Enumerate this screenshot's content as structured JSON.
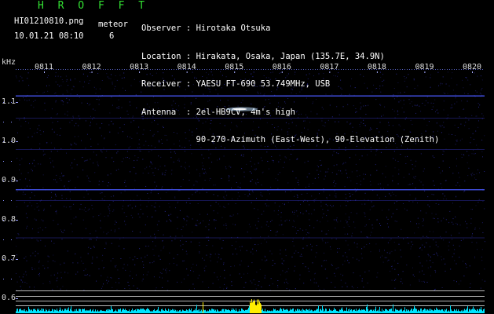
{
  "header": {
    "brand": "H R O F F T",
    "filename": "HI01210810.png",
    "datetime": "10.01.21 08:10",
    "meteor_label": "meteor",
    "meteor_count": "6"
  },
  "station_info": [
    {
      "label": "Observer ",
      "value": "Hirotaka Otsuka"
    },
    {
      "label": "Location ",
      "value": "Hirakata, Osaka, Japan (135.7E, 34.9N)"
    },
    {
      "label": "Receiver ",
      "value": "YAESU FT-690 53.749MHz, USB"
    },
    {
      "label": "Antenna  ",
      "value": "2el-HB9CV, 4m's high"
    },
    {
      "label": "",
      "value": "90-270-Azimuth (East-West), 90-Elevation (Zenith)"
    }
  ],
  "colors": {
    "background": "#000000",
    "brand": "#33e033",
    "text": "#ffffff",
    "noise": "#2a2a9a",
    "carrier_line": "#4a5aff",
    "meteor_echo": "#bfe0ff",
    "spectrum": "#00e5ff",
    "spectrum_peak": "#ffee00",
    "ref_lines": "#b8b8b8"
  },
  "chart_data": {
    "type": "heatmap",
    "title": "",
    "xlabel": "",
    "ylabel": "kHz",
    "x_ticks": [
      "0811",
      "0812",
      "0813",
      "0814",
      "0815",
      "0816",
      "0817",
      "0818",
      "0819",
      "0820"
    ],
    "y_ticks": [
      "1.1",
      "1.0",
      "0.9",
      "0.8",
      "0.7",
      "0.6"
    ],
    "ylim_khz": [
      0.58,
      1.14
    ],
    "carrier_lines_khz": [
      1.117,
      0.878
    ],
    "meteor_echoes": [
      {
        "time": "08:15",
        "freq_khz": 1.08
      }
    ]
  }
}
